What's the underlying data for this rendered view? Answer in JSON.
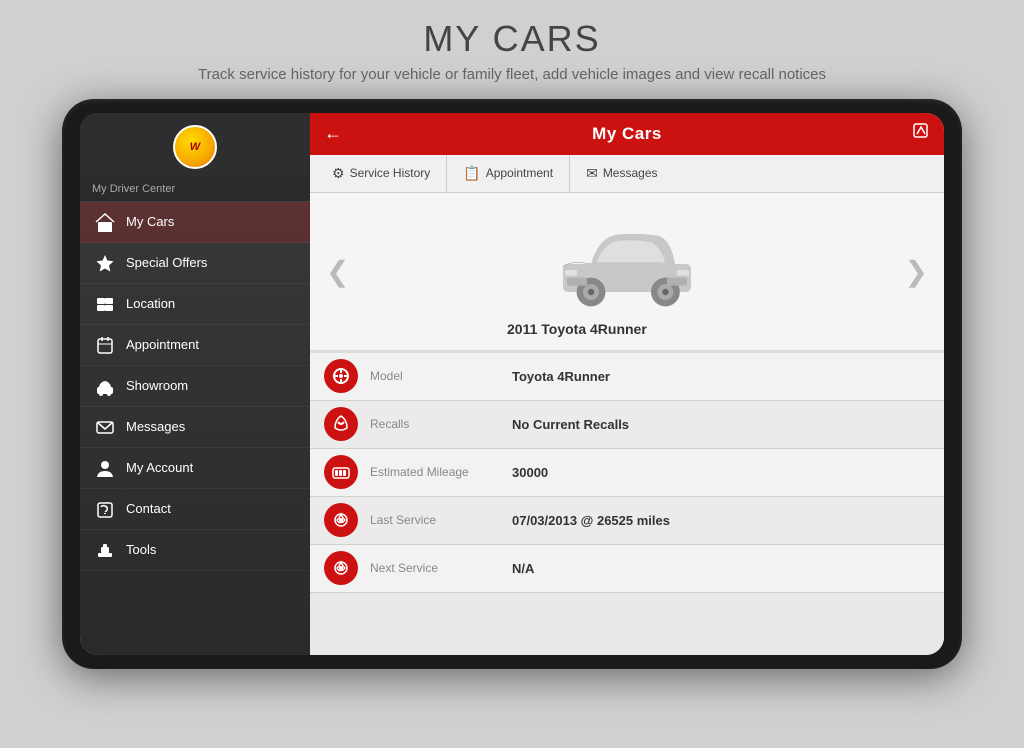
{
  "page": {
    "title": "MY CARS",
    "subtitle": "Track service history for your vehicle or family fleet,\nadd vehicle images and view recall notices"
  },
  "sidebar": {
    "logo_text": "W",
    "driver_center_label": "My Driver Center",
    "items": [
      {
        "id": "my-cars",
        "label": "My Cars",
        "icon": "🏠",
        "active": true
      },
      {
        "id": "special-offers",
        "label": "Special Offers",
        "icon": "★"
      },
      {
        "id": "location",
        "label": "Location",
        "icon": "🗺"
      },
      {
        "id": "appointment",
        "label": "Appointment",
        "icon": "📅"
      },
      {
        "id": "showroom",
        "label": "Showroom",
        "icon": "🚗"
      },
      {
        "id": "messages",
        "label": "Messages",
        "icon": "✉"
      },
      {
        "id": "my-account",
        "label": "My Account",
        "icon": "👤"
      },
      {
        "id": "contact",
        "label": "Contact",
        "icon": "📞"
      },
      {
        "id": "tools",
        "label": "Tools",
        "icon": "🧰"
      }
    ]
  },
  "main_header": {
    "back_icon": "←",
    "title": "My Cars",
    "edit_icon": "✎"
  },
  "tabs": [
    {
      "id": "service-history",
      "label": "Service History",
      "icon": "⚙"
    },
    {
      "id": "appointment",
      "label": "Appointment",
      "icon": "📋"
    },
    {
      "id": "messages",
      "label": "Messages",
      "icon": "✉"
    }
  ],
  "car": {
    "name": "2011 Toyota 4Runner",
    "left_arrow": "❮",
    "right_arrow": "❯"
  },
  "details": [
    {
      "id": "model",
      "icon": "🔴",
      "label": "Model",
      "value": "Toyota 4Runner",
      "icon_type": "wheel"
    },
    {
      "id": "recalls",
      "icon": "🔴",
      "label": "Recalls",
      "value": "No Current Recalls",
      "icon_type": "recall"
    },
    {
      "id": "mileage",
      "icon": "🔴",
      "label": "Estimated Mileage",
      "value": "30000",
      "icon_type": "odometer"
    },
    {
      "id": "last-service",
      "icon": "🔴",
      "label": "Last Service",
      "value": "07/03/2013 @ 26525 miles",
      "icon_type": "service"
    },
    {
      "id": "next-service",
      "icon": "🔴",
      "label": "Next Service",
      "value": "N/A",
      "icon_type": "service"
    }
  ]
}
